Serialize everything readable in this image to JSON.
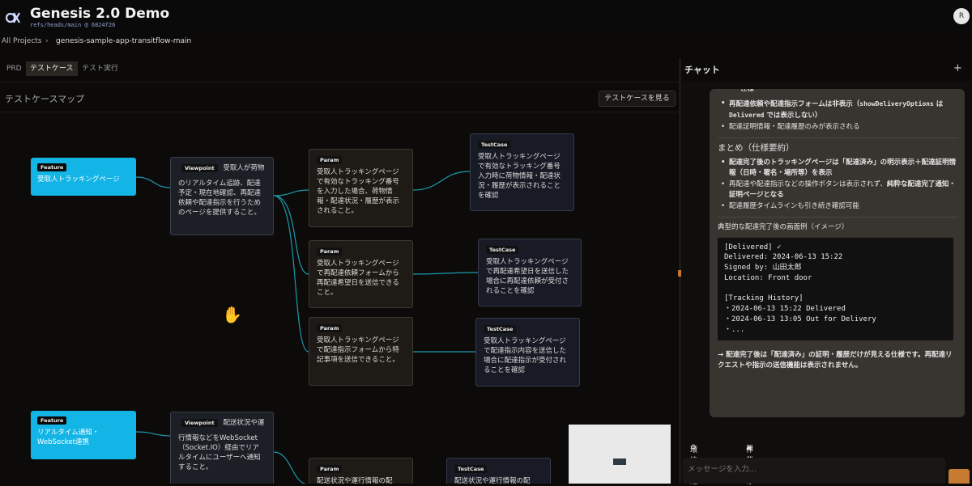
{
  "app": {
    "title": "Genesis 2.0 Demo",
    "ref": "refs/heads/main @ 6824f26",
    "avatar_initial": "R"
  },
  "breadcrumb": {
    "root": "All Projects",
    "separator": "›",
    "current": "genesis-sample-app-transitflow-main"
  },
  "tabs": [
    "PRD",
    "テストケース",
    "テスト実行"
  ],
  "map": {
    "title": "テストケースマップ",
    "view_button": "テストケースを見る",
    "nodes": [
      {
        "type": "Feature",
        "text": "受取人トラッキングページ"
      },
      {
        "type": "Viewpoint",
        "text": "受取人が荷物のリアルタイム追跡、配達予定・現在地確認、再配達依頼や配達指示を行うためのページを提供すること。"
      },
      {
        "type": "Param",
        "text": "受取人トラッキングページで有効なトラッキング番号を入力した場合、荷物情報・配達状況・履歴が表示されること。"
      },
      {
        "type": "TestCase",
        "text": "受取人トラッキングページで有効なトラッキング番号入力時に荷物情報・配達状況・履歴が表示されることを確認"
      },
      {
        "type": "Param",
        "text": "受取人トラッキングページで再配達依頼フォームから再配達希望日を送信できること。"
      },
      {
        "type": "TestCase",
        "text": "受取人トラッキングページで再配達希望日を送信した場合に再配達依頼が受付されることを確認"
      },
      {
        "type": "Param",
        "text": "受取人トラッキングページで配達指示フォームから特記事項を送信できること。"
      },
      {
        "type": "TestCase",
        "text": "受取人トラッキングページで配達指示内容を送信した場合に配達指示が受付されることを確認"
      },
      {
        "type": "Feature",
        "text": "リアルタイム通知・WebSocket連携"
      },
      {
        "type": "Viewpoint",
        "text": "配送状況や運行情報などをWebSocket（Socket.IO）経由でリアルタイムにユーザーへ通知すること。"
      },
      {
        "type": "Param",
        "text": "配送状況や運行情報の配"
      },
      {
        "type": "TestCase",
        "text": "配送状況や運行情報の配"
      }
    ]
  },
  "chat": {
    "title": "チャット",
    "plus": "+",
    "top_cut": "仕様",
    "list1": [
      {
        "pre": "再配達依頼や配達指示フォームは非表示（",
        "code": "showDeliveryOptions",
        "mid": " は ",
        "code2": "Delivered",
        "post": " では表示しない）",
        "bold": true
      },
      {
        "text": "配達証明情報・配達履歴のみが表示される",
        "bold": false
      }
    ],
    "summary_title": "まとめ（仕様要約）",
    "summary": [
      {
        "bold": "配達完了後のトラッキングページは「配達済み」の明示表示＋配達証明情報（日時・署名・場所等）を表示",
        "rest": ""
      },
      {
        "plain": "再配達や配達指示などの操作ボタンは表示されず、",
        "bold": "純粋な配達完了通知・証明ページとなる"
      },
      {
        "plain": "配達履歴タイムラインも引き続き確認可能",
        "bold": ""
      }
    ],
    "example_title": "典型的な配達完了後の画面例（イメージ）",
    "code_block": "[Delivered] ✓\nDelivered: 2024-06-13 15:22\nSigned by: 山田太郎\nLocation: Front door\n\n[Tracking History]\n・2024-06-13 15:22 Delivered\n・2024-06-13 13:05 Out for Delivery\n・...",
    "conclusion": "→ 配達完了後は「配達済み」の証明・履歴だけが見える仕様です。再配達リクエストや指示の送信機能は表示されません。",
    "tool_env": "環境設定",
    "tool_save": "作業保存",
    "input_placeholder": "メッセージを入力..."
  },
  "colors": {
    "feature": "#12b5e6",
    "accent": "#c77a31",
    "edge": "#1fb3c9"
  }
}
